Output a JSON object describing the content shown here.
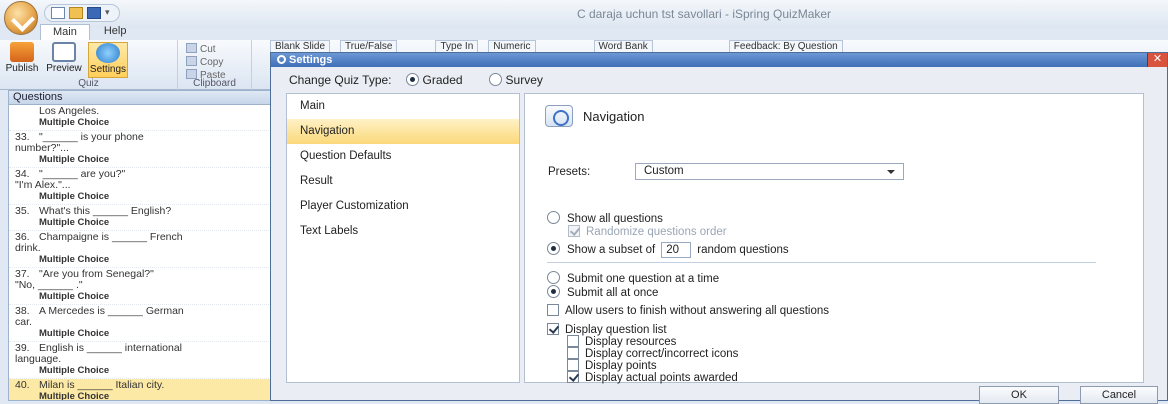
{
  "app": {
    "window_title": "C daraja uchun tst savollari - iSpring QuizMaker",
    "tabs": [
      "Main",
      "Help"
    ]
  },
  "ribbon": {
    "publish": "Publish",
    "preview": "Preview",
    "settings": "Settings",
    "group_quiz": "Quiz",
    "cut": "Cut",
    "copy": "Copy",
    "paste": "Paste",
    "group_clipboard": "Clipboard",
    "blank_slide": "Blank Slide",
    "true_false": "True/False",
    "type_in": "Type In",
    "numeric": "Numeric",
    "word_bank": "Word Bank",
    "feedback": "Feedback: By Question"
  },
  "questions_panel": {
    "header": "Questions",
    "items": [
      {
        "num": "",
        "text": "Los Angeles.",
        "type": "Multiple Choice"
      },
      {
        "num": "33.",
        "text": "\"______ is your phone\nnumber?\"...",
        "type": "Multiple Choice"
      },
      {
        "num": "34.",
        "text": "\"______ are you?\"\n\"I'm Alex.\"...",
        "type": "Multiple Choice"
      },
      {
        "num": "35.",
        "text": "What's this ______ English?",
        "type": "Multiple Choice"
      },
      {
        "num": "36.",
        "text": "Champaigne is ______ French\ndrink.",
        "type": "Multiple Choice"
      },
      {
        "num": "37.",
        "text": "\"Are you from Senegal?\"\n\"No, ______ .\"",
        "type": "Multiple Choice"
      },
      {
        "num": "38.",
        "text": "A Mercedes is ______ German\ncar.",
        "type": "Multiple Choice"
      },
      {
        "num": "39.",
        "text": "English is ______ international\nlanguage.",
        "type": "Multiple Choice"
      },
      {
        "num": "40.",
        "text": "Milan is ______ Italian city.",
        "type": "Multiple Choice"
      }
    ]
  },
  "dialog": {
    "title": "Settings",
    "close": "✕",
    "change_type_label": "Change Quiz Type:",
    "graded": "Graded",
    "survey": "Survey",
    "nav": [
      "Main",
      "Navigation",
      "Question Defaults",
      "Result",
      "Player Customization",
      "Text Labels"
    ],
    "section_title": "Navigation",
    "presets_label": "Presets:",
    "presets_value": "Custom",
    "show_all": "Show all questions",
    "randomize": "Randomize questions order",
    "show_subset": "Show a subset of",
    "subset_count": "20",
    "random_questions": "random questions",
    "submit_one": "Submit one question at a time",
    "submit_all": "Submit all at once",
    "allow_finish": "Allow users to finish without answering all questions",
    "display_list": "Display question list",
    "display_resources": "Display resources",
    "display_icons": "Display correct/incorrect icons",
    "display_points": "Display points",
    "display_awarded": "Display actual points awarded",
    "ok": "OK",
    "cancel": "Cancel"
  }
}
